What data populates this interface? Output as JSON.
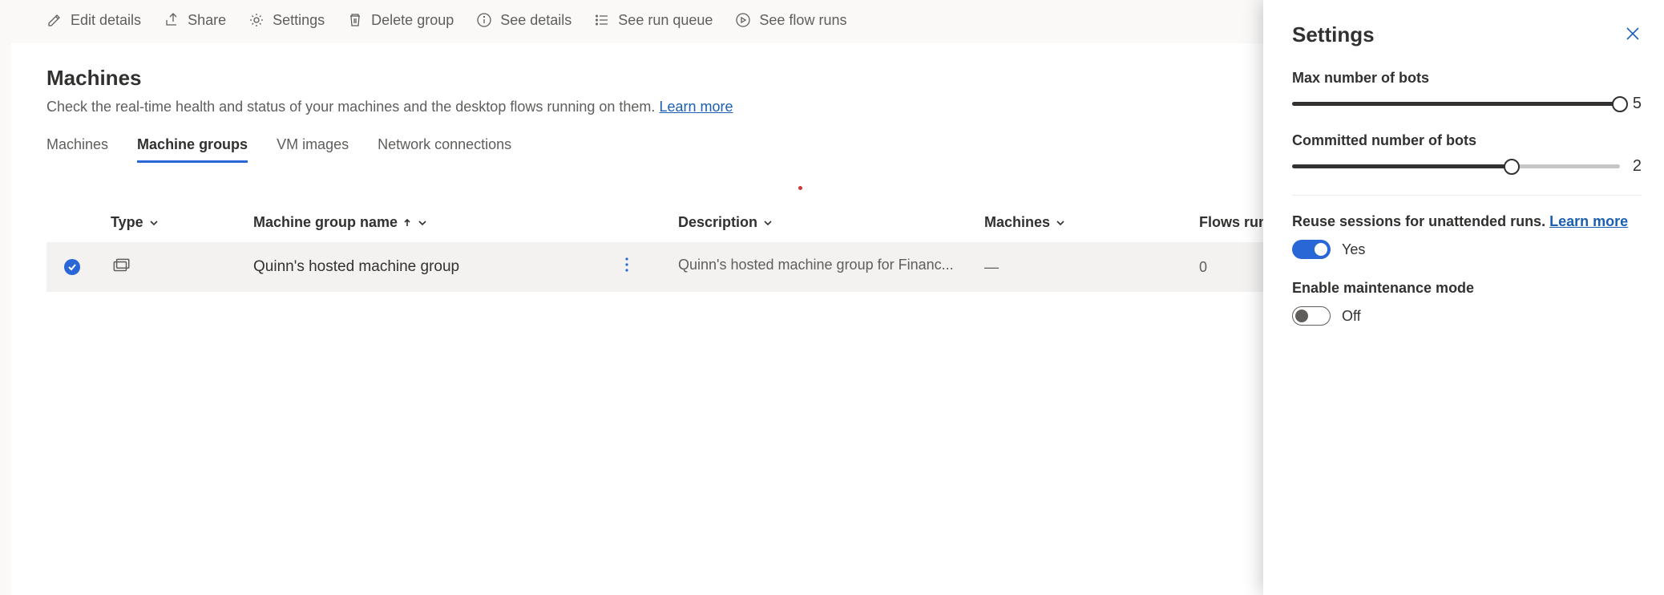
{
  "commandBar": {
    "editDetails": "Edit details",
    "share": "Share",
    "settings": "Settings",
    "deleteGroup": "Delete group",
    "seeDetails": "See details",
    "seeRunQueue": "See run queue",
    "seeFlowRuns": "See flow runs"
  },
  "page": {
    "title": "Machines",
    "descPrefix": "Check the real-time health and status of your machines and the desktop flows running on them. ",
    "learnMore": "Learn more"
  },
  "tabs": {
    "machines": "Machines",
    "machineGroups": "Machine groups",
    "vmImages": "VM images",
    "networkConnections": "Network connections"
  },
  "table": {
    "headers": {
      "type": "Type",
      "name": "Machine group name",
      "desc": "Description",
      "machines": "Machines",
      "flows": "Flows running"
    },
    "rows": [
      {
        "name": "Quinn's hosted machine group",
        "desc": "Quinn's hosted machine group for Financ...",
        "machines": "—",
        "flows": "0"
      }
    ]
  },
  "settings": {
    "title": "Settings",
    "maxBotsLabel": "Max number of bots",
    "maxBotsValue": "5",
    "maxBotsPercent": 100,
    "committedLabel": "Committed number of bots",
    "committedValue": "2",
    "committedPercent": 67,
    "reuseLabel": "Reuse sessions for unattended runs. ",
    "reuseLearnMore": "Learn more",
    "reuseToggleText": "Yes",
    "maintenanceLabel": "Enable maintenance mode",
    "maintenanceToggleText": "Off"
  }
}
